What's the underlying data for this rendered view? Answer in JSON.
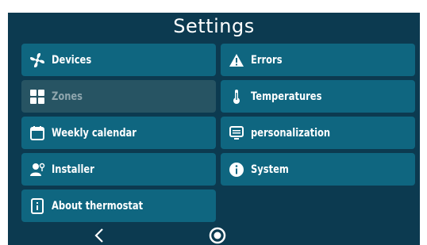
{
  "header": {
    "title": "Settings"
  },
  "menu": {
    "devices": {
      "label": "Devices",
      "icon": "fan-icon"
    },
    "errors": {
      "label": "Errors",
      "icon": "warning-icon"
    },
    "zones": {
      "label": "Zones",
      "icon": "grid-icon",
      "disabled": true
    },
    "temperatures": {
      "label": "Temperatures",
      "icon": "thermometer-icon"
    },
    "weekly_calendar": {
      "label": "Weekly calendar",
      "icon": "calendar-icon"
    },
    "personalization": {
      "label": "personalization",
      "icon": "screen-icon"
    },
    "installer": {
      "label": "Installer",
      "icon": "installer-icon"
    },
    "system": {
      "label": "System",
      "icon": "info-icon"
    },
    "about": {
      "label": "About thermostat",
      "icon": "thermostat-icon"
    }
  },
  "navigation": {
    "back_icon": "chevron-left-icon",
    "home_icon": "home-circle-icon"
  },
  "colors": {
    "background": "#0c3a50",
    "button": "#0f6680",
    "button_disabled": "#275463",
    "text": "#ffffff",
    "text_disabled": "#8fa6ae"
  }
}
